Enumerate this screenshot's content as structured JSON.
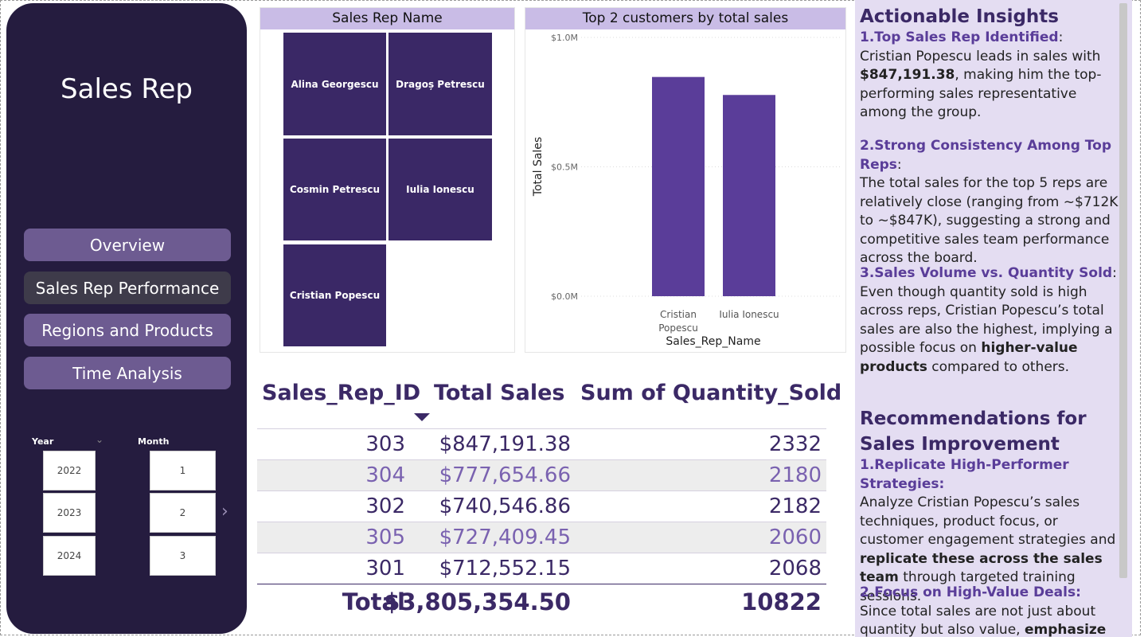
{
  "sidebar": {
    "title": "Sales Rep",
    "nav": [
      "Overview",
      "Sales Rep Performance",
      "Regions and Products",
      "Time Analysis"
    ],
    "year_label": "Year",
    "month_label": "Month",
    "years": [
      "2022",
      "2023",
      "2024"
    ],
    "months": [
      "1",
      "2",
      "3"
    ]
  },
  "treemap": {
    "title": "Sales Rep Name",
    "tiles": [
      "Alina Georgescu",
      "Dragoș Petrescu",
      "Cosmin Petrescu",
      "Iulia Ionescu",
      "Cristian Popescu"
    ]
  },
  "chart_data": {
    "type": "bar",
    "title": "Top 2 customers by total sales",
    "xlabel": "Sales_Rep_Name",
    "ylabel": "Total Sales",
    "categories": [
      "Cristian\nPopescu",
      "Iulia Ionescu"
    ],
    "values": [
      847191.38,
      777654.66
    ],
    "ylim": [
      0,
      1000000
    ],
    "yticks": [
      "$0.0M",
      "$0.5M",
      "$1.0M"
    ],
    "color": "#5a3d99"
  },
  "table": {
    "headers": [
      "Sales_Rep_ID",
      "Total Sales",
      "Sum of Quantity_Sold"
    ],
    "rows": [
      [
        "303",
        "$847,191.38",
        "2332"
      ],
      [
        "304",
        "$777,654.66",
        "2180"
      ],
      [
        "302",
        "$740,546.86",
        "2182"
      ],
      [
        "305",
        "$727,409.45",
        "2060"
      ],
      [
        "301",
        "$712,552.15",
        "2068"
      ]
    ],
    "total": [
      "Total",
      "$3,805,354.50",
      "10822"
    ]
  },
  "insights": {
    "heading": "Actionable Insights",
    "i1_title": "1.Top Sales Rep Identified",
    "i1_a": "Cristian Popescu leads in sales with ",
    "i1_b": "$847,191.38",
    "i1_c": ", making him the top-performing sales representative among the group.",
    "i2_title": "2.Strong Consistency Among Top Reps",
    "i2_a": "The total sales for the top 5 reps are relatively close (ranging from ~$712K to ~$847K), suggesting a strong and competitive sales team performance across the board.",
    "i3_title": "3.Sales Volume vs. Quantity Sold",
    "i3_a": "Even though quantity sold is high across reps, Cristian Popescu’s total sales are also the highest, implying a possible focus on ",
    "i3_b": "higher-value products",
    "i3_c": " compared to others.",
    "rec_heading": "Recommendations for Sales Improvement",
    "r1_title": "1.Replicate High-Performer Strategies:",
    "r1_a": "Analyze Cristian Popescu’s sales techniques, product focus, or customer engagement strategies and ",
    "r1_b": "replicate these across the sales team",
    "r1_c": " through targeted training sessions.",
    "r2_title": "2.Focus on High-Value Deals:",
    "r2_a": "Since total sales are not just about quantity but also value, ",
    "r2_b": "emphasize"
  }
}
